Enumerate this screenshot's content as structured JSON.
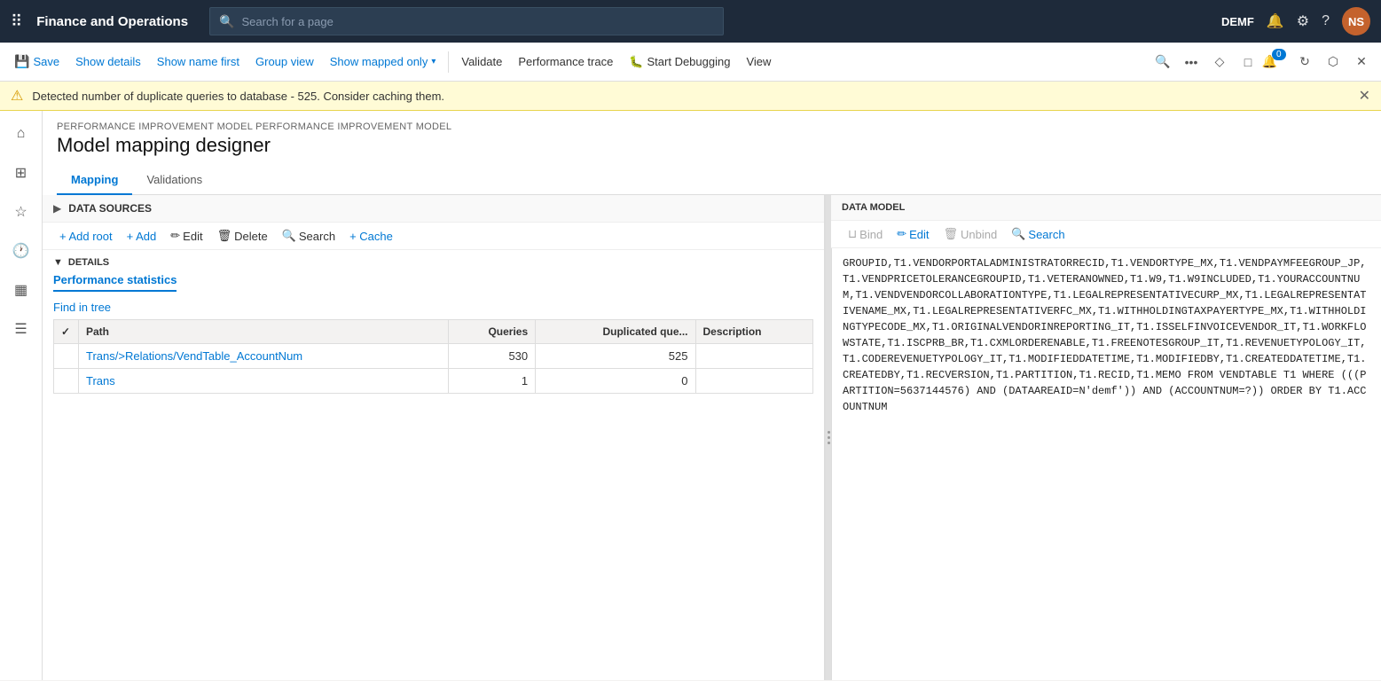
{
  "topnav": {
    "app_title": "Finance and Operations",
    "search_placeholder": "Search for a page",
    "user_label": "DEMF",
    "avatar_initials": "NS"
  },
  "toolbar": {
    "save_label": "Save",
    "show_details_label": "Show details",
    "show_name_first_label": "Show name first",
    "group_view_label": "Group view",
    "show_mapped_only_label": "Show mapped only",
    "validate_label": "Validate",
    "performance_trace_label": "Performance trace",
    "start_debugging_label": "Start Debugging",
    "view_label": "View"
  },
  "warning": {
    "message": "Detected number of duplicate queries to database - 525. Consider caching them."
  },
  "breadcrumb": {
    "text": "PERFORMANCE IMPROVEMENT MODEL PERFORMANCE IMPROVEMENT MODEL"
  },
  "page": {
    "title": "Model mapping designer"
  },
  "tabs": {
    "mapping_label": "Mapping",
    "validations_label": "Validations"
  },
  "datasources": {
    "section_title": "DATA SOURCES",
    "add_root_label": "+ Add root",
    "add_label": "+ Add",
    "edit_label": "Edit",
    "delete_label": "Delete",
    "search_label": "Search",
    "cache_label": "+ Cache"
  },
  "details": {
    "section_title": "DETAILS",
    "tab_label": "Performance statistics",
    "find_in_tree": "Find in tree"
  },
  "table": {
    "headers": [
      "",
      "Path",
      "Queries",
      "Duplicated que...",
      "Description"
    ],
    "rows": [
      {
        "path": "Trans/>Relations/VendTable_AccountNum",
        "queries": "530",
        "duplicated": "525",
        "description": ""
      },
      {
        "path": "Trans",
        "queries": "1",
        "duplicated": "0",
        "description": ""
      }
    ]
  },
  "data_model": {
    "section_title": "DATA MODEL",
    "bind_label": "Bind",
    "edit_label": "Edit",
    "unbind_label": "Unbind",
    "search_label": "Search"
  },
  "sql_text": "GROUPID,T1.VENDORPORTALADMINISTRATORRECID,T1.VENDORTYPE_MX,T1.VENDPAYMFEEGROUP_JP,T1.VENDPRICETOLERANCEGROUPID,T1.VETERANOWNED,T1.W9,T1.W9INCLUDED,T1.YOURACCOUNTNUM,T1.VENDVENDORCOLLABORATIONTYPE,T1.LEGALREPRESENTATIVECURP_MX,T1.LEGALREPRESENTATIVENAME_MX,T1.LEGALREPRESENTATIVERFC_MX,T1.WITHHOLDINGTAXPAYERTYPE_MX,T1.WITHHOLDINGTYPECODE_MX,T1.ORIGINALVENDORINREPORTING_IT,T1.ISSELFINVOICEVENDOR_IT,T1.WORKFLOWSTATE,T1.ISCPRB_BR,T1.CXMLORDERENABLE,T1.FREENOTESGROUP_IT,T1.REVENUETYPOLOGY_IT,T1.CODEREVENUETYPOLOGY_IT,T1.MODIFIEDDATETIME,T1.MODIFIEDBY,T1.CREATEDDATETIME,T1.CREATEDBY,T1.RECVERSION,T1.PARTITION,T1.RECID,T1.MEMO FROM VENDTABLE T1 WHERE (((PARTITION=5637144576) AND (DATAAREAID=N'demf')) AND (ACCOUNTNUM=?)) ORDER BY T1.ACCOUNTNUM"
}
